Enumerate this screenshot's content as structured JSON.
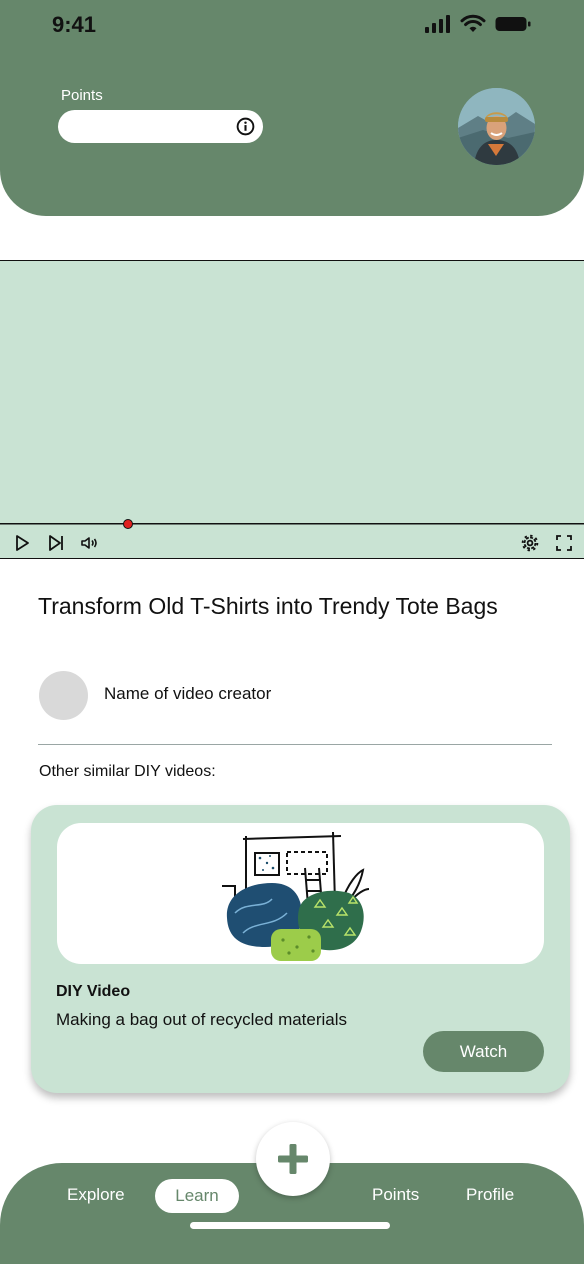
{
  "status_bar": {
    "time": "9:41"
  },
  "header": {
    "points_label": "Points"
  },
  "video": {
    "progress": 0.22
  },
  "content": {
    "title": "Transform Old T-Shirts into Trendy Tote Bags",
    "creator_name": "Name of video creator",
    "similar_heading": "Other similar DIY videos:"
  },
  "card": {
    "type": "DIY Video",
    "description": "Making a bag out of recycled materials",
    "watch_label": "Watch"
  },
  "nav": {
    "explore": "Explore",
    "learn": "Learn",
    "points": "Points",
    "profile": "Profile"
  },
  "colors": {
    "primary": "#66876b",
    "light": "#c9e3d3",
    "progress_dot": "#e02020"
  }
}
